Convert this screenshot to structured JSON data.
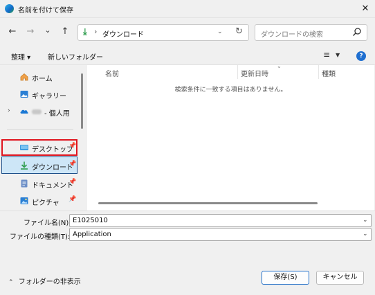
{
  "window": {
    "title": "名前を付けて保存",
    "close_icon": "close-icon"
  },
  "nav": {
    "back": "←",
    "forward": "→",
    "recent": "⌄",
    "up": "↑"
  },
  "address": {
    "folder": "ダウンロード",
    "separator": "›"
  },
  "search": {
    "placeholder": "ダウンロードの検索"
  },
  "toolbar": {
    "organize": "整理 ▾",
    "new_folder": "新しいフォルダー",
    "help": "?"
  },
  "sidebar": {
    "items": [
      {
        "label": "ホーム",
        "icon": "home-icon"
      },
      {
        "label": "ギャラリー",
        "icon": "gallery-icon"
      },
      {
        "label": "- 個人用",
        "icon": "onedrive-icon"
      },
      {
        "label": "デスクトップ",
        "icon": "desktop-icon",
        "pinned": true
      },
      {
        "label": "ダウンロード",
        "icon": "download-icon",
        "pinned": true
      },
      {
        "label": "ドキュメント",
        "icon": "document-icon",
        "pinned": true
      },
      {
        "label": "ピクチャ",
        "icon": "pictures-icon",
        "pinned": true
      }
    ]
  },
  "file_list": {
    "columns": [
      "名前",
      "更新日時",
      "種類"
    ],
    "empty_message": "検索条件に一致する項目はありません。"
  },
  "form": {
    "filename_label": "ファイル名(N):",
    "filename_value": "E1025010",
    "filetype_label": "ファイルの種類(T):",
    "filetype_value": "Application"
  },
  "footer": {
    "hide_folders": "フォルダーの非表示",
    "save": "保存(S)",
    "cancel": "キャンセル"
  },
  "colors": {
    "accent": "#1f6fd0",
    "selection_bg": "#cde6f7",
    "highlight_red": "#e0141e",
    "download_green": "#2f9d4e"
  }
}
